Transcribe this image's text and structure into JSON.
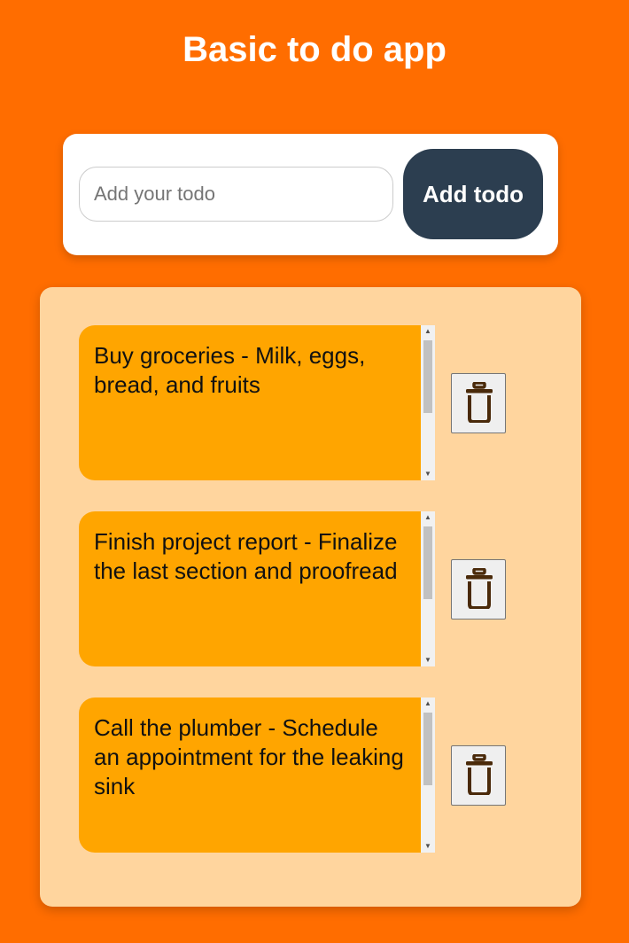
{
  "header": {
    "title": "Basic to do app"
  },
  "add_form": {
    "placeholder": "Add your todo",
    "value": "",
    "button_label": "Add todo"
  },
  "todos": [
    {
      "text": "Buy groceries - Milk, eggs, bread, and fruits",
      "delete_icon": "trash-icon"
    },
    {
      "text": "Finish project report - Finalize the last section and proofread",
      "delete_icon": "trash-icon"
    },
    {
      "text": "Call the plumber - Schedule an appointment for the leaking sink",
      "delete_icon": "trash-icon"
    }
  ],
  "colors": {
    "background": "#ff6d00",
    "card": "#ffffff",
    "button": "#2c3e50",
    "panel": "#ffd59e",
    "todo_item": "#ffa500",
    "trash_icon": "#4a2a0a"
  }
}
